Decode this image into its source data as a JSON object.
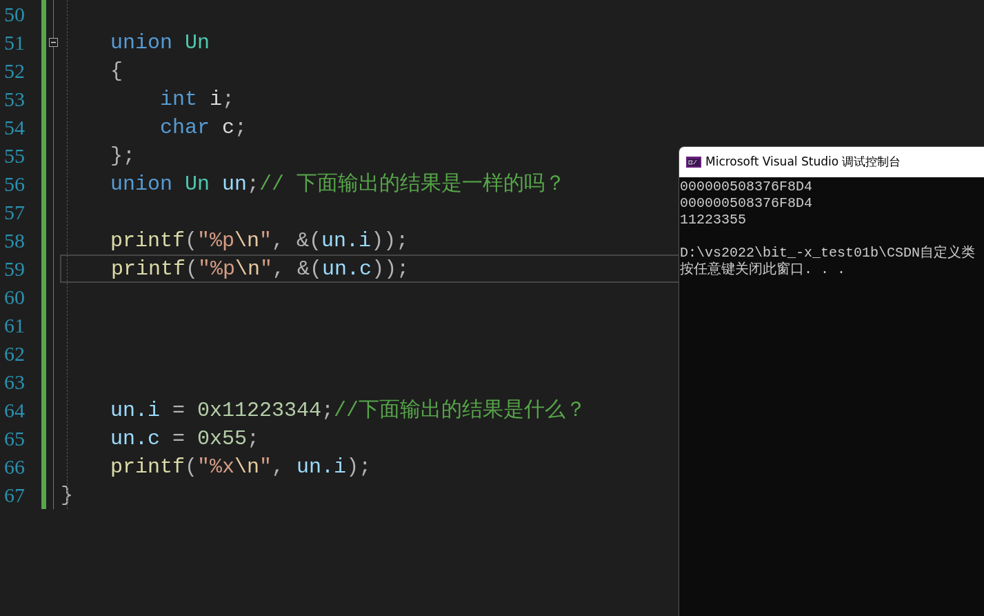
{
  "editor": {
    "lines": [
      {
        "number": "50",
        "current": false,
        "fold_start": false
      },
      {
        "number": "51",
        "current": false,
        "fold_start": true,
        "tokens": [
          {
            "kind": "keyword",
            "text": "    union "
          },
          {
            "kind": "type",
            "text": "Un"
          }
        ]
      },
      {
        "number": "52",
        "current": false,
        "fold_start": false,
        "tokens": [
          {
            "kind": "punct",
            "text": "    {"
          }
        ]
      },
      {
        "number": "53",
        "current": false,
        "fold_start": false,
        "tokens": [
          {
            "kind": "keyword",
            "text": "        int "
          },
          {
            "kind": "field",
            "text": "i"
          },
          {
            "kind": "punct",
            "text": ";"
          }
        ]
      },
      {
        "number": "54",
        "current": false,
        "fold_start": false,
        "tokens": [
          {
            "kind": "keyword",
            "text": "        char "
          },
          {
            "kind": "field",
            "text": "c"
          },
          {
            "kind": "punct",
            "text": ";"
          }
        ]
      },
      {
        "number": "55",
        "current": false,
        "fold_start": false,
        "tokens": [
          {
            "kind": "punct",
            "text": "    };"
          }
        ]
      },
      {
        "number": "56",
        "current": false,
        "fold_start": false,
        "tokens": [
          {
            "kind": "keyword",
            "text": "    union "
          },
          {
            "kind": "type",
            "text": "Un "
          },
          {
            "kind": "var",
            "text": "un"
          },
          {
            "kind": "punct",
            "text": ";"
          },
          {
            "kind": "comment",
            "text": "// 下面输出的结果是一样的吗？"
          }
        ]
      },
      {
        "number": "57",
        "current": false,
        "fold_start": false
      },
      {
        "number": "58",
        "current": false,
        "fold_start": false,
        "tokens": [
          {
            "kind": "func",
            "text": "    printf"
          },
          {
            "kind": "punct",
            "text": "("
          },
          {
            "kind": "string",
            "text": "\"%p"
          },
          {
            "kind": "escape",
            "text": "\\n"
          },
          {
            "kind": "string",
            "text": "\""
          },
          {
            "kind": "punct",
            "text": ", &("
          },
          {
            "kind": "var",
            "text": "un.i"
          },
          {
            "kind": "punct",
            "text": "));"
          }
        ]
      },
      {
        "number": "59",
        "current": true,
        "fold_start": false,
        "tokens": [
          {
            "kind": "func",
            "text": "    printf"
          },
          {
            "kind": "punct",
            "text": "("
          },
          {
            "kind": "string",
            "text": "\"%p"
          },
          {
            "kind": "escape",
            "text": "\\n"
          },
          {
            "kind": "string",
            "text": "\""
          },
          {
            "kind": "punct",
            "text": ", &("
          },
          {
            "kind": "var",
            "text": "un.c"
          },
          {
            "kind": "punct",
            "text": "));"
          }
        ]
      },
      {
        "number": "60",
        "current": false,
        "fold_start": false
      },
      {
        "number": "61",
        "current": false,
        "fold_start": false
      },
      {
        "number": "62",
        "current": false,
        "fold_start": false
      },
      {
        "number": "63",
        "current": false,
        "fold_start": false
      },
      {
        "number": "64",
        "current": false,
        "fold_start": false,
        "tokens": [
          {
            "kind": "var",
            "text": "    un.i"
          },
          {
            "kind": "punct",
            "text": " = "
          },
          {
            "kind": "number",
            "text": "0x11223344"
          },
          {
            "kind": "punct",
            "text": ";"
          },
          {
            "kind": "comment",
            "text": "//下面输出的结果是什么？"
          }
        ]
      },
      {
        "number": "65",
        "current": false,
        "fold_start": false,
        "tokens": [
          {
            "kind": "var",
            "text": "    un.c"
          },
          {
            "kind": "punct",
            "text": " = "
          },
          {
            "kind": "number",
            "text": "0x55"
          },
          {
            "kind": "punct",
            "text": ";"
          }
        ]
      },
      {
        "number": "66",
        "current": false,
        "fold_start": false,
        "tokens": [
          {
            "kind": "func",
            "text": "    printf"
          },
          {
            "kind": "punct",
            "text": "("
          },
          {
            "kind": "string",
            "text": "\"%x"
          },
          {
            "kind": "escape",
            "text": "\\n"
          },
          {
            "kind": "string",
            "text": "\""
          },
          {
            "kind": "punct",
            "text": ", "
          },
          {
            "kind": "var",
            "text": "un.i"
          },
          {
            "kind": "punct",
            "text": ");"
          }
        ]
      },
      {
        "number": "67",
        "current": false,
        "fold_start": false,
        "tokens": [
          {
            "kind": "punct",
            "text": "}"
          }
        ]
      }
    ]
  },
  "console": {
    "title": "Microsoft Visual Studio 调试控制台",
    "output": [
      "000000508376F8D4",
      "000000508376F8D4",
      "11223355"
    ],
    "message": [
      "D:\\vs2022\\bit_-x_test01b\\CSDN自定义类",
      "按任意键关闭此窗口. . ."
    ]
  }
}
